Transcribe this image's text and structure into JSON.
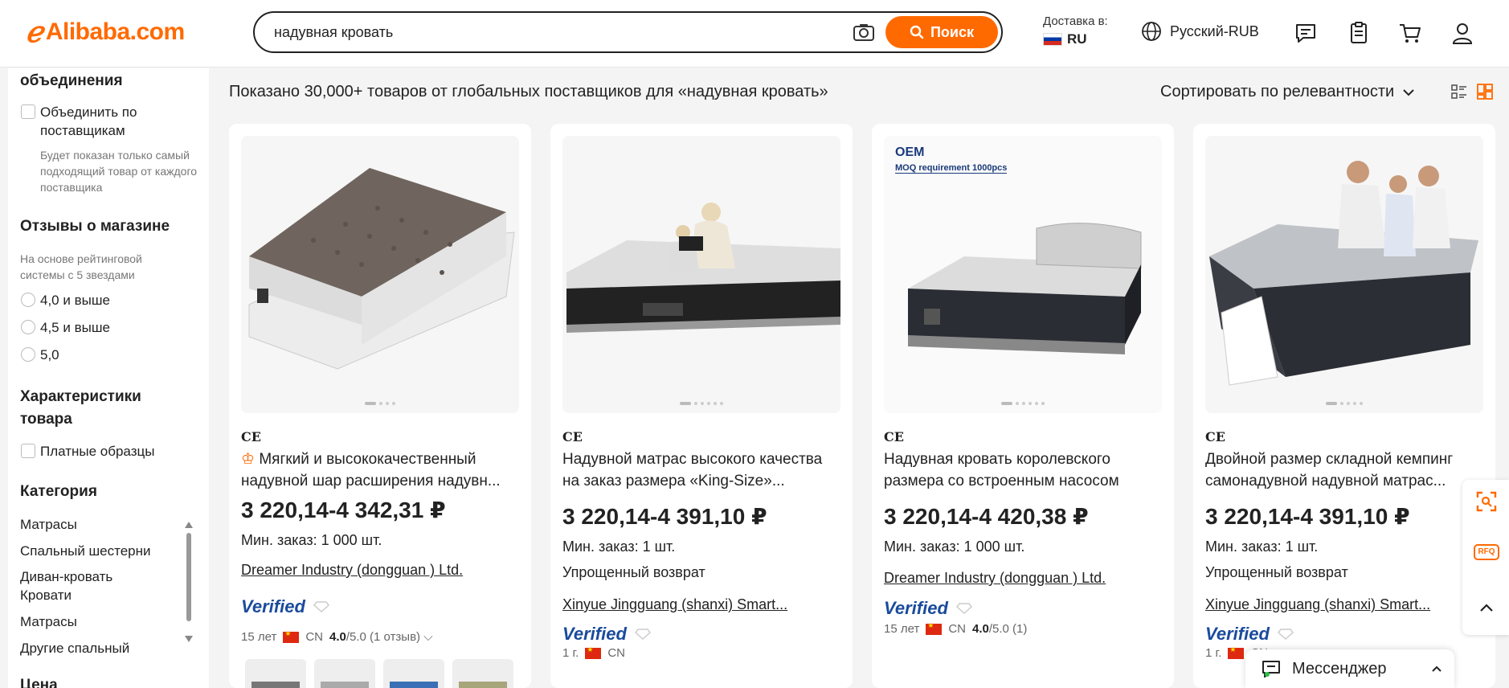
{
  "header": {
    "logo_text": "Alibaba.com",
    "search_value": "надувная кровать",
    "search_button": "Поиск",
    "deliver_label": "Доставка в:",
    "deliver_country": "RU",
    "language": "Русский-RUB",
    "icons": [
      "messages-icon",
      "orders-icon",
      "cart-icon",
      "account-icon"
    ]
  },
  "sidebar": {
    "merge_heading": "объединения",
    "merge_option": "Объединить по поставщикам",
    "merge_note": "Будет показан только самый подходящий товар от каждого поставщика",
    "reviews_heading": "Отзывы о магазине",
    "reviews_note": "На основе рейтинговой системы с 5 звездами",
    "ratings": [
      "4,0 и выше",
      "4,5 и выше",
      "5,0"
    ],
    "features_heading": "Характеристики товара",
    "paid_samples": "Платные образцы",
    "category_heading": "Категория",
    "categories": [
      "Матрасы",
      "Спальный шестерни",
      "Диван-кровать Кровати",
      "Матрасы",
      "Другие спальный"
    ],
    "price_heading": "Цена"
  },
  "main": {
    "results_title": "Показано 30,000+ товаров от глобальных поставщиков для «надувная кровать»",
    "sort_label": "Сортировать по релевантности"
  },
  "products": [
    {
      "cert": "CE",
      "title": "Мягкий и высококачественный надувной шар расширения надувн...",
      "price": "3 220,14-4 342,31 ₽",
      "moq": "Мин. заказ: 1 000 шт.",
      "supplier": "Dreamer Industry (dongguan ) Ltd.",
      "verified": "Verified",
      "years": "15 лет",
      "country": "CN",
      "rating": "4.0",
      "rating_suffix": "/5.0 (1 отзыв)"
    },
    {
      "cert": "CE",
      "title": "Надувной матрас высокого качества на заказ размера «King-Size»...",
      "price": "3 220,14-4 391,10 ₽",
      "moq": "Мин. заказ: 1 шт.",
      "return": "Упрощенный возврат",
      "supplier": "Xinyue Jingguang (shanxi) Smart...",
      "verified": "Verified",
      "years": "1 г.",
      "country": "CN"
    },
    {
      "cert": "CE",
      "badge_oem": "OEM",
      "badge_moq": "MOQ requirement 1000pcs",
      "title": "Надувная кровать королевского размера со встроенным насосом",
      "price": "3 220,14-4 420,38 ₽",
      "moq": "Мин. заказ: 1 000 шт.",
      "supplier": "Dreamer Industry (dongguan ) Ltd.",
      "verified": "Verified",
      "years": "15 лет",
      "country": "CN",
      "rating": "4.0",
      "rating_suffix": "/5.0 (1)"
    },
    {
      "cert": "CE",
      "title": "Двойной размер складной кемпинг самонадувной надувной матрас...",
      "price": "3 220,14-4 391,10 ₽",
      "moq": "Мин. заказ: 1 шт.",
      "return": "Упрощенный возврат",
      "supplier": "Xinyue Jingguang (shanxi) Smart...",
      "verified": "Verified",
      "years": "1 г.",
      "country": "CN"
    }
  ],
  "float_panel": {
    "rfq_label": "RFQ"
  },
  "messenger": {
    "label": "Мессенджер"
  },
  "colors": {
    "brand_orange": "#ff6a00",
    "verified_blue": "#1a4b9c",
    "background": "#f4f4f4"
  }
}
